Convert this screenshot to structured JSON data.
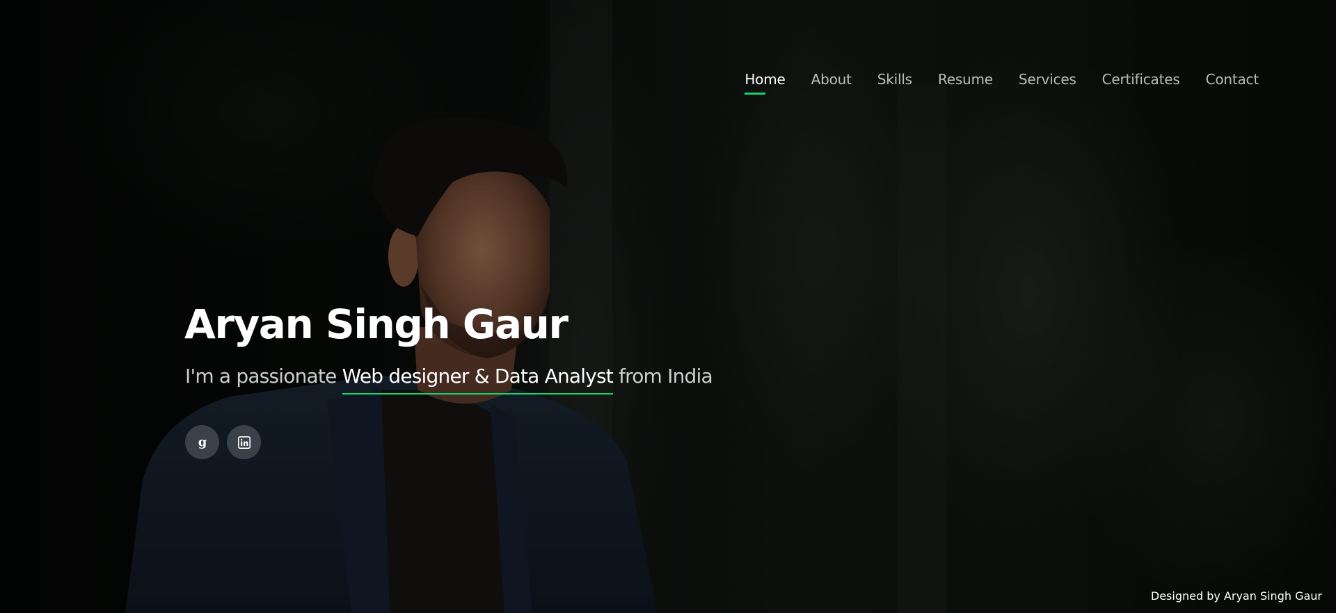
{
  "nav": {
    "items": [
      {
        "label": "Home",
        "active": true
      },
      {
        "label": "About",
        "active": false
      },
      {
        "label": "Skills",
        "active": false
      },
      {
        "label": "Resume",
        "active": false
      },
      {
        "label": "Services",
        "active": false
      },
      {
        "label": "Certificates",
        "active": false
      },
      {
        "label": "Contact",
        "active": false
      }
    ]
  },
  "hero": {
    "name": "Aryan Singh Gaur",
    "tagline_prefix": "I'm a passionate ",
    "tagline_highlight": "Web designer & Data Analyst",
    "tagline_suffix": " from India"
  },
  "social": {
    "items": [
      {
        "icon": "goodreads-icon"
      },
      {
        "icon": "linkedin-icon"
      }
    ]
  },
  "footer": {
    "credit": "Designed by Aryan Singh Gaur"
  },
  "colors": {
    "accent": "#18d26e",
    "text": "#ffffff"
  }
}
